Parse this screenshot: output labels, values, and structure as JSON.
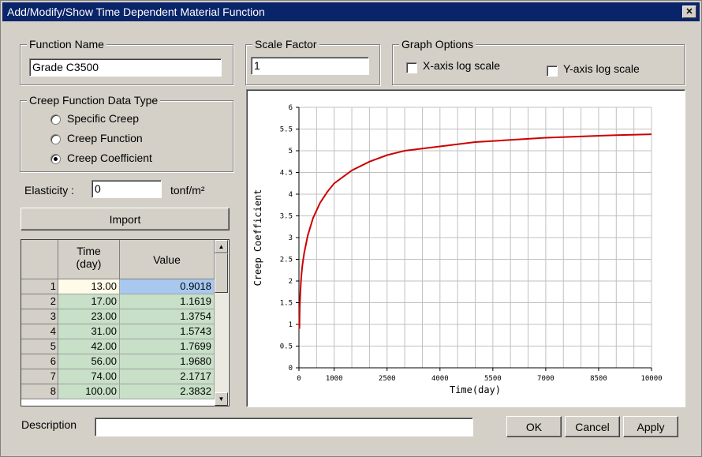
{
  "window": {
    "title": "Add/Modify/Show Time Dependent Material Function",
    "close_glyph": "✕"
  },
  "function_name": {
    "label": "Function Name",
    "value": "Grade C3500"
  },
  "scale_factor": {
    "label": "Scale Factor",
    "value": "1"
  },
  "graph_options": {
    "label": "Graph Options",
    "x_log": {
      "label": "X-axis log scale",
      "checked": false
    },
    "y_log": {
      "label": "Y-axis log scale",
      "checked": false
    }
  },
  "creep_type": {
    "label": "Creep Function Data Type",
    "options": [
      {
        "label": "Specific Creep",
        "selected": false
      },
      {
        "label": "Creep Function",
        "selected": false
      },
      {
        "label": "Creep Coefficient",
        "selected": true
      }
    ]
  },
  "elasticity": {
    "label": "Elasticity :",
    "value": "0",
    "unit": "tonf/m²"
  },
  "import_label": "Import",
  "table": {
    "headers": [
      "Time\n(day)",
      "Value"
    ],
    "rows": [
      {
        "n": "1",
        "time": "13.00",
        "value": "0.9018"
      },
      {
        "n": "2",
        "time": "17.00",
        "value": "1.1619"
      },
      {
        "n": "3",
        "time": "23.00",
        "value": "1.3754"
      },
      {
        "n": "4",
        "time": "31.00",
        "value": "1.5743"
      },
      {
        "n": "5",
        "time": "42.00",
        "value": "1.7699"
      },
      {
        "n": "6",
        "time": "56.00",
        "value": "1.9680"
      },
      {
        "n": "7",
        "time": "74.00",
        "value": "2.1717"
      },
      {
        "n": "8",
        "time": "100.00",
        "value": "2.3832"
      }
    ]
  },
  "description": {
    "label": "Description",
    "value": ""
  },
  "buttons": {
    "ok": "OK",
    "cancel": "Cancel",
    "apply": "Apply"
  },
  "colors": {
    "titlebar": "#0a246a",
    "curve": "#cc0000",
    "selected_cell": "#a8c8f0",
    "data_cell": "#c8e0c8"
  },
  "chart_data": {
    "type": "line",
    "xlabel": "Time(day)",
    "ylabel": "Creep Coefficient",
    "xlim": [
      0,
      10000
    ],
    "ylim": [
      0,
      6
    ],
    "xticks": [
      0,
      1000,
      2500,
      4000,
      5500,
      7000,
      8500,
      10000
    ],
    "yticks": [
      0,
      0.5,
      1,
      1.5,
      2,
      2.5,
      3,
      3.5,
      4,
      4.5,
      5,
      5.5,
      6
    ],
    "grid": true,
    "series": [
      {
        "x": [
          13,
          17,
          23,
          31,
          42,
          56,
          74,
          100,
          150,
          250,
          400,
          600,
          800,
          1000,
          1500,
          2000,
          2500,
          3000,
          3500,
          4000,
          5000,
          6000,
          7000,
          8000,
          9000,
          10000
        ],
        "y": [
          0.9,
          1.16,
          1.38,
          1.57,
          1.77,
          1.97,
          2.17,
          2.38,
          2.65,
          3.05,
          3.45,
          3.8,
          4.05,
          4.25,
          4.55,
          4.75,
          4.9,
          5.0,
          5.05,
          5.1,
          5.2,
          5.25,
          5.3,
          5.33,
          5.36,
          5.38
        ]
      }
    ]
  }
}
